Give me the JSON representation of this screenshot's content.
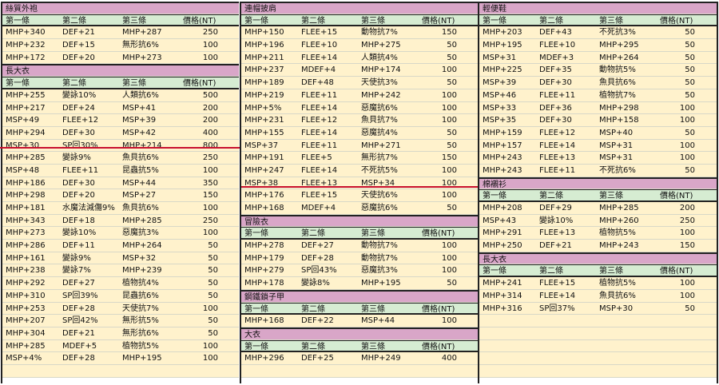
{
  "header_labels": [
    "第一條",
    "第二條",
    "第三條",
    "價格(NT)"
  ],
  "columns": [
    {
      "sections": [
        {
          "title": "絲質外袍",
          "rows": [
            [
              "MHP+340",
              "DEF+21",
              "MHP+287",
              "250"
            ],
            [
              "MHP+232",
              "DEF+15",
              "無形抗6%",
              "100"
            ],
            [
              "MHP+172",
              "DEF+20",
              "MHP+273",
              "100"
            ]
          ]
        },
        {
          "title": "長大衣",
          "rows": [
            [
              "MHP+255",
              "變詠10%",
              "人類抗6%",
              "500"
            ],
            [
              "MHP+217",
              "DEF+24",
              "MSP+41",
              "200"
            ],
            [
              "MSP+49",
              "FLEE+12",
              "MSP+39",
              "200"
            ],
            [
              "MHP+294",
              "DEF+30",
              "MSP+42",
              "400"
            ],
            [
              "MSP+30",
              "SP回30%",
              "MHP+214",
              "800"
            ],
            [
              "MHP+285",
              "變詠9%",
              "魚貝抗6%",
              "250"
            ],
            [
              "MSP+48",
              "FLEE+11",
              "昆蟲抗5%",
              "100"
            ],
            [
              "MHP+186",
              "DEF+30",
              "MSP+44",
              "350"
            ],
            [
              "MHP+298",
              "DEF+20",
              "MSP+27",
              "150"
            ],
            [
              "MHP+181",
              "水魔法減傷9%",
              "魚貝抗6%",
              "100"
            ],
            [
              "MHP+343",
              "DEF+18",
              "MHP+285",
              "250"
            ],
            [
              "MHP+273",
              "變詠10%",
              "惡魔抗3%",
              "100"
            ],
            [
              "MHP+286",
              "DEF+11",
              "MHP+264",
              "50"
            ],
            [
              "MHP+161",
              "變詠9%",
              "MSP+32",
              "50"
            ],
            [
              "MHP+238",
              "變詠7%",
              "MHP+239",
              "50"
            ],
            [
              "MHP+292",
              "DEF+27",
              "植物抗4%",
              "50"
            ],
            [
              "MHP+310",
              "SP回39%",
              "昆蟲抗6%",
              "50"
            ],
            [
              "MHP+253",
              "DEF+28",
              "天使抗7%",
              "100"
            ],
            [
              "MHP+207",
              "SP回42%",
              "無形抗5%",
              "50"
            ],
            [
              "MHP+304",
              "DEF+21",
              "無形抗6%",
              "50"
            ],
            [
              "MHP+285",
              "MDEF+5",
              "植物抗5%",
              "100"
            ],
            [
              "MSP+4%",
              "DEF+28",
              "MHP+195",
              "100"
            ]
          ]
        }
      ]
    },
    {
      "sections": [
        {
          "title": "連帽披肩",
          "rows": [
            [
              "MHP+150",
              "FLEE+15",
              "動物抗7%",
              "150"
            ],
            [
              "MHP+196",
              "FLEE+10",
              "MHP+275",
              "50"
            ],
            [
              "MHP+211",
              "FLEE+14",
              "人類抗4%",
              "50"
            ],
            [
              "MHP+237",
              "MDEF+4",
              "MHP+174",
              "100"
            ],
            [
              "MHP+189",
              "DEF+48",
              "天使抗3%",
              "50"
            ],
            [
              "MHP+219",
              "FLEE+11",
              "MHP+242",
              "100"
            ],
            [
              "MHP+5%",
              "FLEE+14",
              "惡魔抗6%",
              "100"
            ],
            [
              "MHP+231",
              "FLEE+12",
              "魚貝抗7%",
              "100"
            ],
            [
              "MHP+155",
              "FLEE+14",
              "惡魔抗4%",
              "50"
            ],
            [
              "MSP+37",
              "FLEE+11",
              "MHP+271",
              "50"
            ],
            [
              "MHP+191",
              "FLEE+5",
              "無形抗7%",
              "150"
            ],
            [
              "MHP+247",
              "FLEE+14",
              "不死抗5%",
              "100"
            ],
            [
              "MSP+38",
              "FLEE+13",
              "MSP+34",
              "100"
            ],
            [
              "MHP+176",
              "FLEE+15",
              "天使抗6%",
              "100"
            ],
            [
              "MHP+168",
              "MDEF+4",
              "惡魔抗6%",
              "50"
            ]
          ]
        },
        {
          "title": "冒險衣",
          "rows": [
            [
              "MHP+278",
              "DEF+27",
              "動物抗7%",
              "100"
            ],
            [
              "MHP+179",
              "DEF+28",
              "動物抗7%",
              "100"
            ],
            [
              "MHP+279",
              "SP回43%",
              "惡魔抗3%",
              "100"
            ],
            [
              "MHP+178",
              "變詠8%",
              "MHP+195",
              "50"
            ]
          ]
        },
        {
          "title": "鋼鐵鎖子甲",
          "rows": [
            [
              "MHP+168",
              "DEF+22",
              "MSP+44",
              "100"
            ]
          ]
        },
        {
          "title": "大衣",
          "rows": [
            [
              "MHP+296",
              "DEF+25",
              "MHP+249",
              "400"
            ]
          ]
        }
      ]
    },
    {
      "sections": [
        {
          "title": "輕便鞋",
          "rows": [
            [
              "MHP+203",
              "DEF+43",
              "不死抗3%",
              "50"
            ],
            [
              "MHP+195",
              "FLEE+10",
              "MHP+295",
              "50"
            ],
            [
              "MSP+31",
              "MDEF+3",
              "MHP+264",
              "50"
            ],
            [
              "MHP+225",
              "DEF+35",
              "動物抗5%",
              "50"
            ],
            [
              "MSP+39",
              "DEF+30",
              "魚貝抗6%",
              "50"
            ],
            [
              "MSP+46",
              "FLEE+11",
              "植物抗7%",
              "50"
            ],
            [
              "MSP+33",
              "DEF+36",
              "MHP+298",
              "100"
            ],
            [
              "MSP+35",
              "DEF+30",
              "MHP+158",
              "100"
            ],
            [
              "MHP+159",
              "FLEE+12",
              "MSP+40",
              "50"
            ],
            [
              "MHP+157",
              "FLEE+14",
              "MSP+31",
              "100"
            ],
            [
              "MHP+243",
              "FLEE+13",
              "MSP+31",
              "100"
            ],
            [
              "MHP+243",
              "FLEE+11",
              "不死抗6%",
              "50"
            ]
          ]
        },
        {
          "title": "棉襯衫",
          "rows": [
            [
              "MHP+208",
              "DEF+29",
              "MHP+285",
              "200"
            ],
            [
              "MSP+43",
              "變詠10%",
              "MHP+260",
              "250"
            ],
            [
              "MHP+291",
              "FLEE+13",
              "植物抗5%",
              "100"
            ],
            [
              "MHP+250",
              "DEF+21",
              "MHP+243",
              "150"
            ]
          ]
        },
        {
          "title": "長大衣",
          "rows": [
            [
              "MHP+241",
              "FLEE+15",
              "植物抗5%",
              "100"
            ],
            [
              "MHP+314",
              "FLEE+14",
              "魚貝抗6%",
              "100"
            ],
            [
              "MHP+316",
              "SP回37%",
              "MSP+30",
              "50"
            ]
          ]
        }
      ]
    }
  ]
}
